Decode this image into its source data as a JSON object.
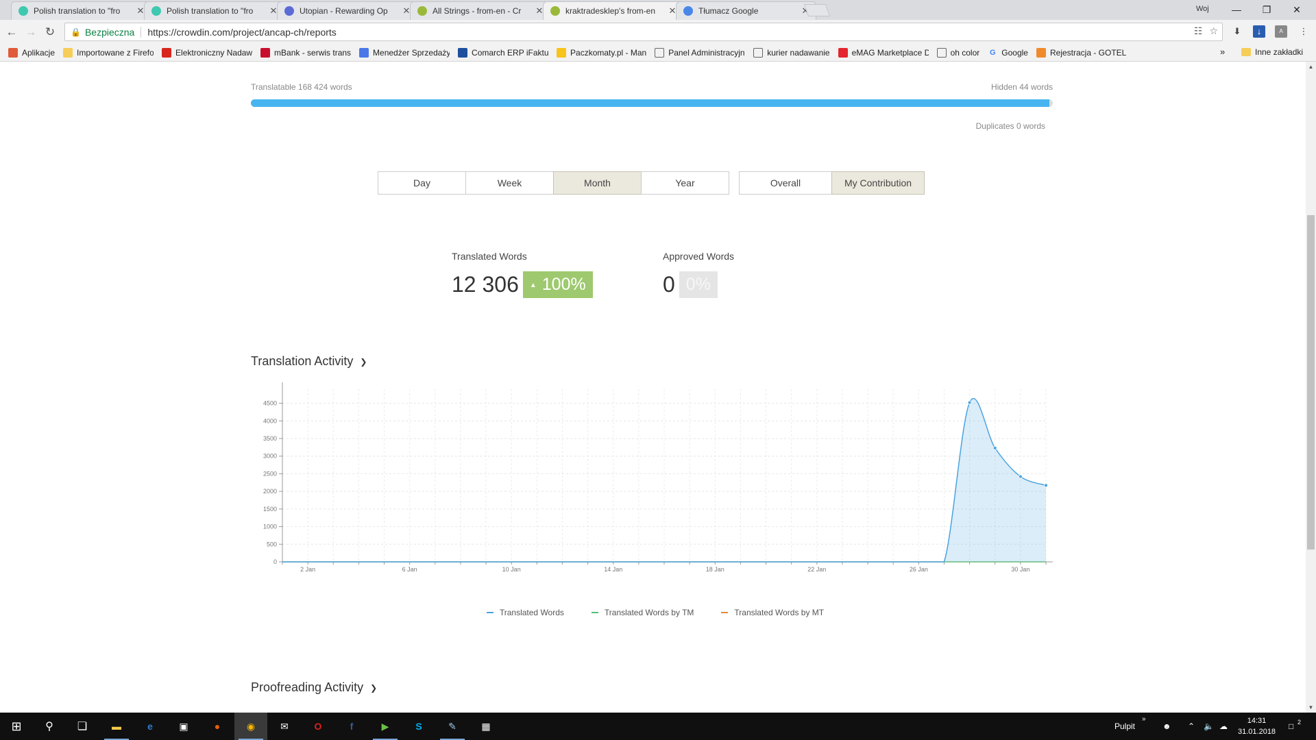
{
  "browser": {
    "tabs": [
      {
        "title": "Polish translation to \"fro",
        "favicon_color": "#3ec9b0",
        "active": false
      },
      {
        "title": "Polish translation to \"fro",
        "favicon_color": "#3ec9b0",
        "active": false
      },
      {
        "title": "Utopian - Rewarding Op",
        "favicon_color": "#5b6bd6",
        "active": false
      },
      {
        "title": "All Strings - from-en - Cr",
        "favicon_color": "#9ab93a",
        "active": false
      },
      {
        "title": "kraktradesklep's from-en",
        "favicon_color": "#9ab93a",
        "active": true
      },
      {
        "title": "Tłumacz Google",
        "favicon_color": "#4a86e8",
        "active": false
      }
    ],
    "user": "Woj",
    "secure_label": "Bezpieczna",
    "url": "https://crowdin.com/project/ancap-ch/reports",
    "bookmarks": [
      {
        "label": "Aplikacje",
        "icon": "apps-grid-icon"
      },
      {
        "label": "Importowane z Firefo",
        "icon": "folder-icon"
      },
      {
        "label": "Elektroniczny Nadaw",
        "icon": "post-icon"
      },
      {
        "label": "mBank - serwis transa",
        "icon": "mbank-icon"
      },
      {
        "label": "Menedżer Sprzedaży",
        "icon": "messenger-icon"
      },
      {
        "label": "Comarch ERP iFaktury",
        "icon": "comarch-icon"
      },
      {
        "label": "Paczkomaty.pl - Man",
        "icon": "paczkomaty-icon"
      },
      {
        "label": "Panel Administracyjny",
        "icon": "page-icon"
      },
      {
        "label": "kurier nadawanie",
        "icon": "page-icon"
      },
      {
        "label": "eMAG Marketplace D",
        "icon": "emag-icon"
      },
      {
        "label": "oh color",
        "icon": "page-icon"
      },
      {
        "label": "Google",
        "icon": "google-icon"
      },
      {
        "label": "Rejestracja - GOTEL I",
        "icon": "gotel-icon"
      }
    ],
    "bookmarks_more": "»",
    "other_bookmarks": "Inne zakładki"
  },
  "report": {
    "translatable": "Translatable 168 424 words",
    "hidden": "Hidden 44 words",
    "duplicates": "Duplicates 0 words",
    "progress_translatable_fraction": 0.996,
    "periods": [
      {
        "label": "Day",
        "selected": false
      },
      {
        "label": "Week",
        "selected": false
      },
      {
        "label": "Month",
        "selected": true
      },
      {
        "label": "Year",
        "selected": false
      }
    ],
    "scopes": [
      {
        "label": "Overall",
        "selected": false
      },
      {
        "label": "My Contribution",
        "selected": true
      }
    ],
    "translated": {
      "label": "Translated Words",
      "value": "12 306",
      "badge": "100%",
      "arrow": "▲"
    },
    "approved": {
      "label": "Approved Words",
      "value": "0",
      "badge": "0%"
    },
    "translation_activity_title": "Translation Activity",
    "proofreading_activity_title": "Proofreading Activity"
  },
  "chart_data": {
    "type": "area",
    "x": [
      "1 Jan",
      "2 Jan",
      "3 Jan",
      "4 Jan",
      "5 Jan",
      "6 Jan",
      "7 Jan",
      "8 Jan",
      "9 Jan",
      "10 Jan",
      "11 Jan",
      "12 Jan",
      "13 Jan",
      "14 Jan",
      "15 Jan",
      "16 Jan",
      "17 Jan",
      "18 Jan",
      "19 Jan",
      "20 Jan",
      "21 Jan",
      "22 Jan",
      "23 Jan",
      "24 Jan",
      "25 Jan",
      "26 Jan",
      "27 Jan",
      "28 Jan",
      "29 Jan",
      "30 Jan",
      "31 Jan"
    ],
    "x_tick_labels": [
      "2 Jan",
      "6 Jan",
      "10 Jan",
      "14 Jan",
      "18 Jan",
      "22 Jan",
      "26 Jan",
      "30 Jan"
    ],
    "x_tick_index": [
      1,
      5,
      9,
      13,
      17,
      21,
      25,
      29
    ],
    "y_ticks": [
      0,
      500,
      1000,
      1500,
      2000,
      2500,
      3000,
      3500,
      4000,
      4500
    ],
    "ylim": [
      0,
      4900
    ],
    "grid": true,
    "legend_position": "bottom",
    "series": [
      {
        "name": "Translated Words",
        "color": "#4aa3df",
        "values": [
          0,
          0,
          0,
          0,
          0,
          0,
          0,
          0,
          0,
          0,
          0,
          0,
          0,
          0,
          0,
          0,
          0,
          0,
          0,
          0,
          0,
          0,
          0,
          0,
          0,
          0,
          0,
          4520,
          3230,
          2420,
          2170
        ]
      },
      {
        "name": "Translated Words by TM",
        "color": "#4fbf7a",
        "values": [
          0,
          0,
          0,
          0,
          0,
          0,
          0,
          0,
          0,
          0,
          0,
          0,
          0,
          0,
          0,
          0,
          0,
          0,
          0,
          0,
          0,
          0,
          0,
          0,
          0,
          0,
          0,
          0,
          0,
          0,
          0
        ]
      },
      {
        "name": "Translated Words by MT",
        "color": "#e08a3c",
        "values": [
          0,
          0,
          0,
          0,
          0,
          0,
          0,
          0,
          0,
          0,
          0,
          0,
          0,
          0,
          0,
          0,
          0,
          0,
          0,
          0,
          0,
          0,
          0,
          0,
          0,
          0,
          0,
          0,
          0,
          0,
          0
        ]
      }
    ]
  },
  "taskbar": {
    "apps": [
      {
        "name": "file-explorer-icon",
        "glyph": "▬",
        "color": "#f2c94c",
        "running": true,
        "active": false
      },
      {
        "name": "edge-icon",
        "glyph": "e",
        "color": "#2f7dd1",
        "running": false,
        "active": false
      },
      {
        "name": "store-icon",
        "glyph": "▣",
        "color": "#ffffff",
        "running": false,
        "active": false
      },
      {
        "name": "firefox-icon",
        "glyph": "●",
        "color": "#e66000",
        "running": false,
        "active": false
      },
      {
        "name": "chrome-icon",
        "glyph": "◉",
        "color": "#f4b400",
        "running": true,
        "active": true
      },
      {
        "name": "mail-icon",
        "glyph": "✉",
        "color": "#ffffff",
        "running": false,
        "active": false
      },
      {
        "name": "opera-icon",
        "glyph": "O",
        "color": "#e02020",
        "running": false,
        "active": false
      },
      {
        "name": "facebook-icon",
        "glyph": "f",
        "color": "#3b5998",
        "running": false,
        "active": false
      },
      {
        "name": "presentation-icon",
        "glyph": "▶",
        "color": "#6ac045",
        "running": true,
        "active": false
      },
      {
        "name": "skype-icon",
        "glyph": "S",
        "color": "#00aff0",
        "running": false,
        "active": false
      },
      {
        "name": "paint-icon",
        "glyph": "✎",
        "color": "#9fc6e7",
        "running": true,
        "active": false
      },
      {
        "name": "calculator-icon",
        "glyph": "▦",
        "color": "#ffffff",
        "running": false,
        "active": false
      }
    ],
    "desktop_label": "Pulpit",
    "time": "14:31",
    "date": "31.01.2018",
    "notification_count": "2"
  }
}
